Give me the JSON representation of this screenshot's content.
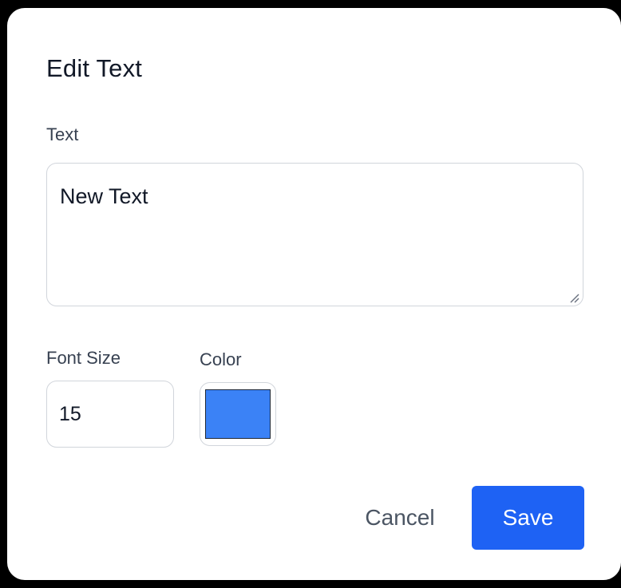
{
  "dialog": {
    "title": "Edit Text",
    "text_field": {
      "label": "Text",
      "value": "New Text"
    },
    "font_size_field": {
      "label": "Font Size",
      "value": "15"
    },
    "color_field": {
      "label": "Color",
      "value": "#3b82f6"
    },
    "buttons": {
      "cancel_label": "Cancel",
      "save_label": "Save"
    }
  },
  "colors": {
    "primary": "#1e62f4",
    "swatch": "#3b82f6",
    "border": "#d1d5db"
  }
}
